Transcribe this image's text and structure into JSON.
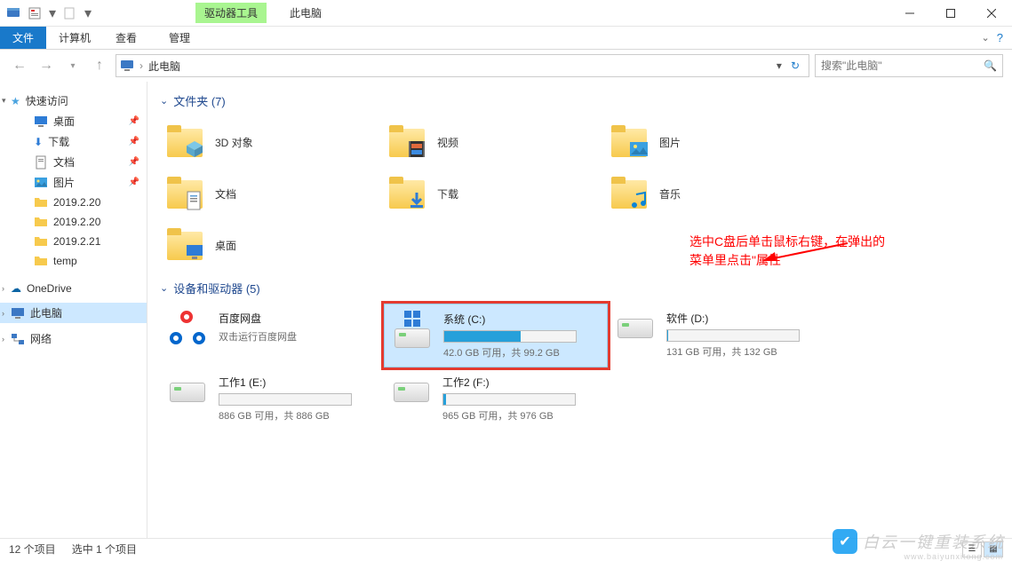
{
  "window": {
    "title": "此电脑",
    "context_tab": "驱动器工具",
    "context_sub": "管理"
  },
  "ribbon": {
    "file": "文件",
    "computer": "计算机",
    "view": "查看"
  },
  "address": {
    "root": "此电脑",
    "search_placeholder": "搜索\"此电脑\""
  },
  "sidebar": {
    "quick_access": "快速访问",
    "items": [
      {
        "label": "桌面",
        "pinned": true
      },
      {
        "label": "下载",
        "pinned": true
      },
      {
        "label": "文档",
        "pinned": true
      },
      {
        "label": "图片",
        "pinned": true
      },
      {
        "label": "2019.2.20",
        "pinned": false
      },
      {
        "label": "2019.2.20",
        "pinned": false
      },
      {
        "label": "2019.2.21",
        "pinned": false
      },
      {
        "label": "temp",
        "pinned": false
      }
    ],
    "onedrive": "OneDrive",
    "this_pc": "此电脑",
    "network": "网络"
  },
  "sections": {
    "folders_title": "文件夹 (7)",
    "devices_title": "设备和驱动器 (5)"
  },
  "folders": [
    {
      "label": "3D 对象",
      "overlay": "cube"
    },
    {
      "label": "视频",
      "overlay": "film"
    },
    {
      "label": "图片",
      "overlay": "photo"
    },
    {
      "label": "文档",
      "overlay": "doc"
    },
    {
      "label": "下载",
      "overlay": "down"
    },
    {
      "label": "音乐",
      "overlay": "music"
    },
    {
      "label": "桌面",
      "overlay": "desk"
    }
  ],
  "drives": [
    {
      "name": "百度网盘",
      "sub": "双击运行百度网盘",
      "type": "baidu"
    },
    {
      "name": "系统 (C:)",
      "sub": "42.0 GB 可用，共 99.2 GB",
      "type": "os",
      "fill": 58,
      "selected": true
    },
    {
      "name": "软件 (D:)",
      "sub": "131 GB 可用，共 132 GB",
      "type": "hdd",
      "fill": 1
    },
    {
      "name": "工作1 (E:)",
      "sub": "886 GB 可用，共 886 GB",
      "type": "hdd",
      "fill": 0
    },
    {
      "name": "工作2 (F:)",
      "sub": "965 GB 可用，共 976 GB",
      "type": "hdd",
      "fill": 2
    }
  ],
  "annotation": {
    "line1": "选中C盘后单击鼠标右键，在弹出的",
    "line2": "菜单里点击\"属性"
  },
  "status": {
    "items": "12 个项目",
    "selected": "选中 1 个项目"
  },
  "watermark": {
    "text": "白云一键重装系统",
    "sub": "www.baiyunxitong.com"
  }
}
